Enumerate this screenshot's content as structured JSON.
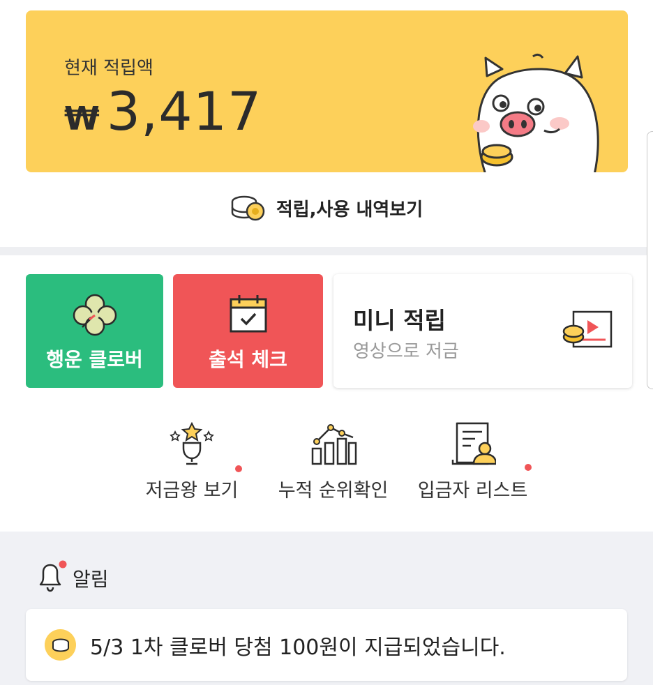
{
  "balance": {
    "label": "현재 적립액",
    "currency": "₩",
    "amount": "3,417"
  },
  "history_link": {
    "label": "적립,사용 내역보기"
  },
  "tiles": {
    "clover": {
      "label": "행운 클로버",
      "color": "#2bbd7e"
    },
    "attendance": {
      "label": "출석 체크",
      "color": "#f05557"
    },
    "mini": {
      "title": "미니 적립",
      "subtitle": "영상으로 저금"
    }
  },
  "shortcuts": [
    {
      "label": "저금왕 보기",
      "icon": "trophy-icon",
      "has_badge": true
    },
    {
      "label": "누적 순위확인",
      "icon": "ranking-chart-icon",
      "has_badge": false
    },
    {
      "label": "입금자 리스트",
      "icon": "depositor-list-icon",
      "has_badge": true
    }
  ],
  "notices": {
    "title": "알림",
    "items": [
      {
        "text": "5/3 1차 클로버 당첨 100원이 지급되었습니다."
      }
    ]
  },
  "colors": {
    "banner": "#fdd05a",
    "accent_red": "#f05557",
    "accent_green": "#2bbd7e"
  }
}
